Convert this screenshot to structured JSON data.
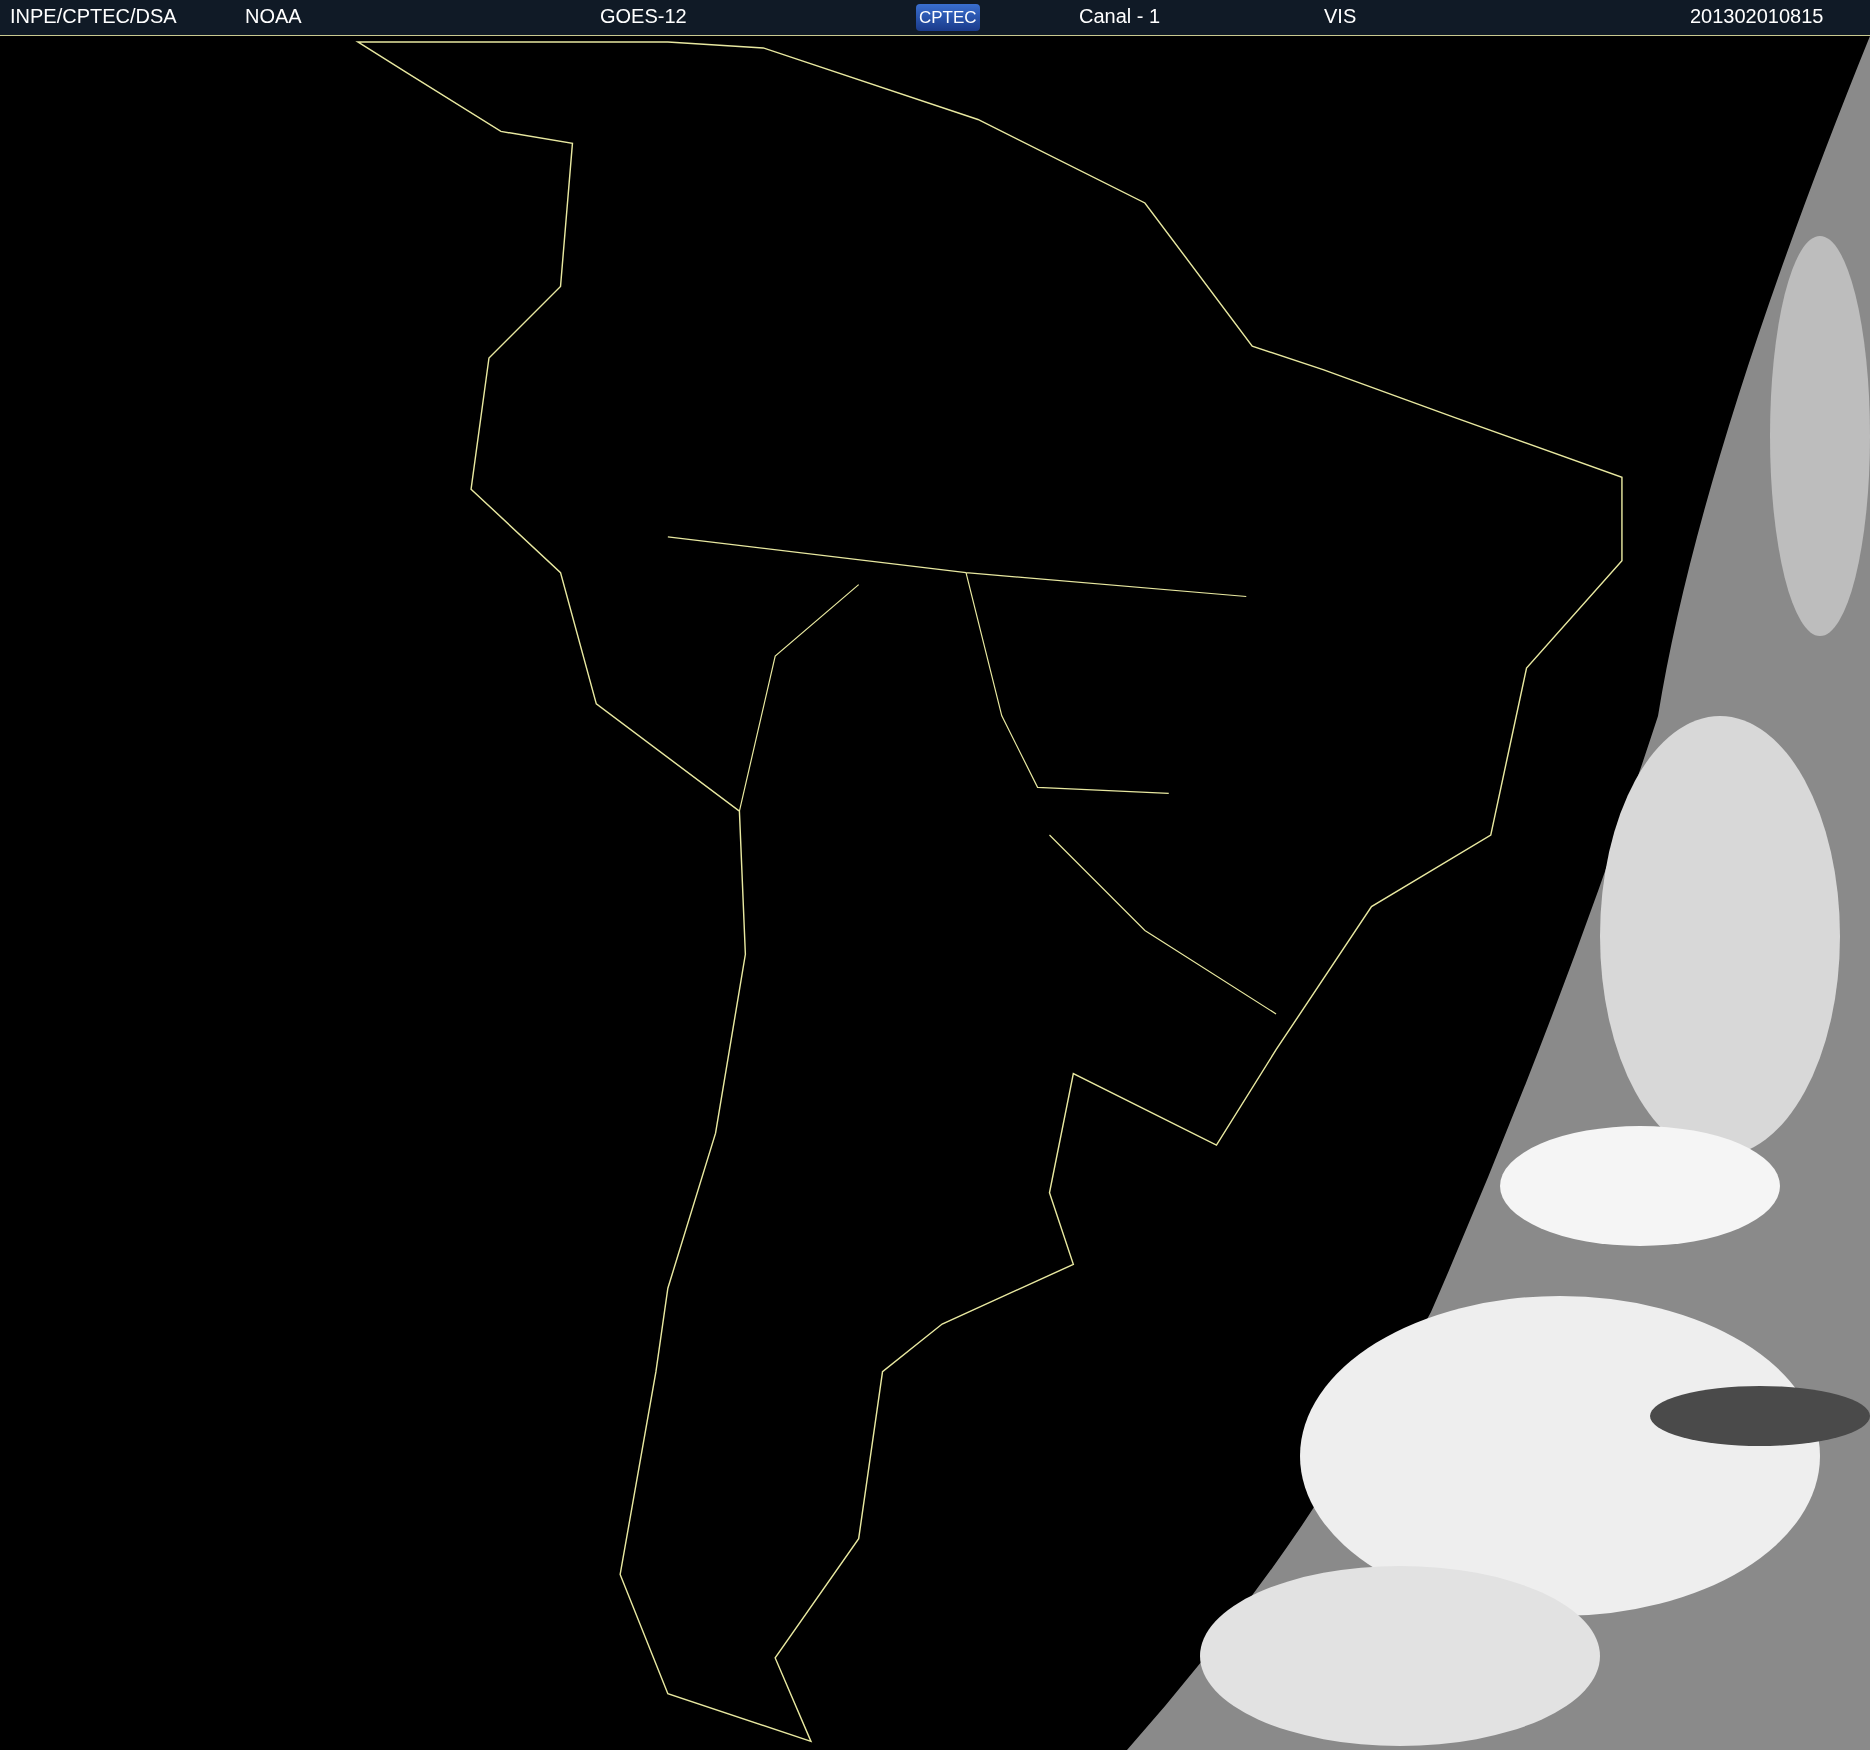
{
  "header": {
    "items": [
      {
        "kind": "text",
        "text": "INPE/CPTEC/DSA"
      },
      {
        "kind": "text",
        "text": "NOAA"
      },
      {
        "kind": "text",
        "text": "GOES-12"
      },
      {
        "kind": "logo",
        "text": "CPTEC"
      },
      {
        "kind": "text",
        "text": "Canal - 1"
      },
      {
        "kind": "text",
        "text": "VIS"
      },
      {
        "kind": "text",
        "text": "201302010815"
      }
    ]
  }
}
